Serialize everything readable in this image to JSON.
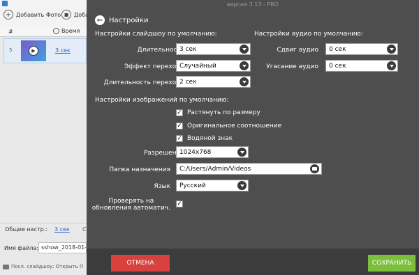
{
  "background": {
    "toolbar": {
      "add_photo_label": "Добавить Фото",
      "add_music_label": "Доба"
    },
    "table": {
      "col_num": "#",
      "col_time": "Время",
      "rows": [
        {
          "num": "5",
          "duration": "3 сек"
        }
      ]
    },
    "status": {
      "label": "Общие настр.:",
      "value": "3 сек",
      "extra": "С"
    },
    "file": {
      "label": "Имя файла:",
      "value": "sshow_2018-01-"
    },
    "last_slideshow": "Посл. слайдшоу: Открыть П"
  },
  "panel": {
    "version": "версия 3.13 - PRO",
    "title": "Настройки",
    "slideshow_section": "Настройки слайдшоу по умолчанию:",
    "audio_section": "Настройки аудио по умолчанию:",
    "duration": {
      "label": "Длительность",
      "value": "3 сек"
    },
    "transition": {
      "label": "Эффект перехода",
      "value": "Случайный"
    },
    "transition_duration": {
      "label": "Длительность перехода",
      "value": "2 сек"
    },
    "audio_shift": {
      "label": "Сдвиг аудио",
      "value": "0 сек"
    },
    "audio_fade": {
      "label": "Угасание аудио",
      "value": "0 сек"
    },
    "image_section": "Настройки изображений по умолчанию:",
    "checkboxes": {
      "stretch": {
        "label": "Растянуть по размеру",
        "checked": true
      },
      "original_ratio": {
        "label": "Оригинальное соотношение",
        "checked": true
      },
      "watermark": {
        "label": "Водяной знак",
        "checked": true
      }
    },
    "resolution": {
      "label": "Разрешение",
      "value": "1024x768"
    },
    "destination": {
      "label": "Папка назначения",
      "value": "C:/Users/Admin/Videos"
    },
    "language": {
      "label": "Язык",
      "value": "Русский"
    },
    "check_updates": {
      "label_line1": "Проверять на",
      "label_line2": "обновления автоматич.",
      "checked": true
    },
    "cancel_label": "ОТМЕНА",
    "save_label": "СОХРАНИТЬ"
  },
  "colors": {
    "cancel": "#d8413d",
    "save": "#7cbf3a",
    "panel": "#4e4e4e",
    "link": "#2a64c5"
  },
  "icons": [
    "app-icon",
    "add-icon",
    "folder-icon",
    "clock-icon",
    "play-icon",
    "back-icon",
    "dropdown-icon",
    "checkbox-check-icon"
  ]
}
